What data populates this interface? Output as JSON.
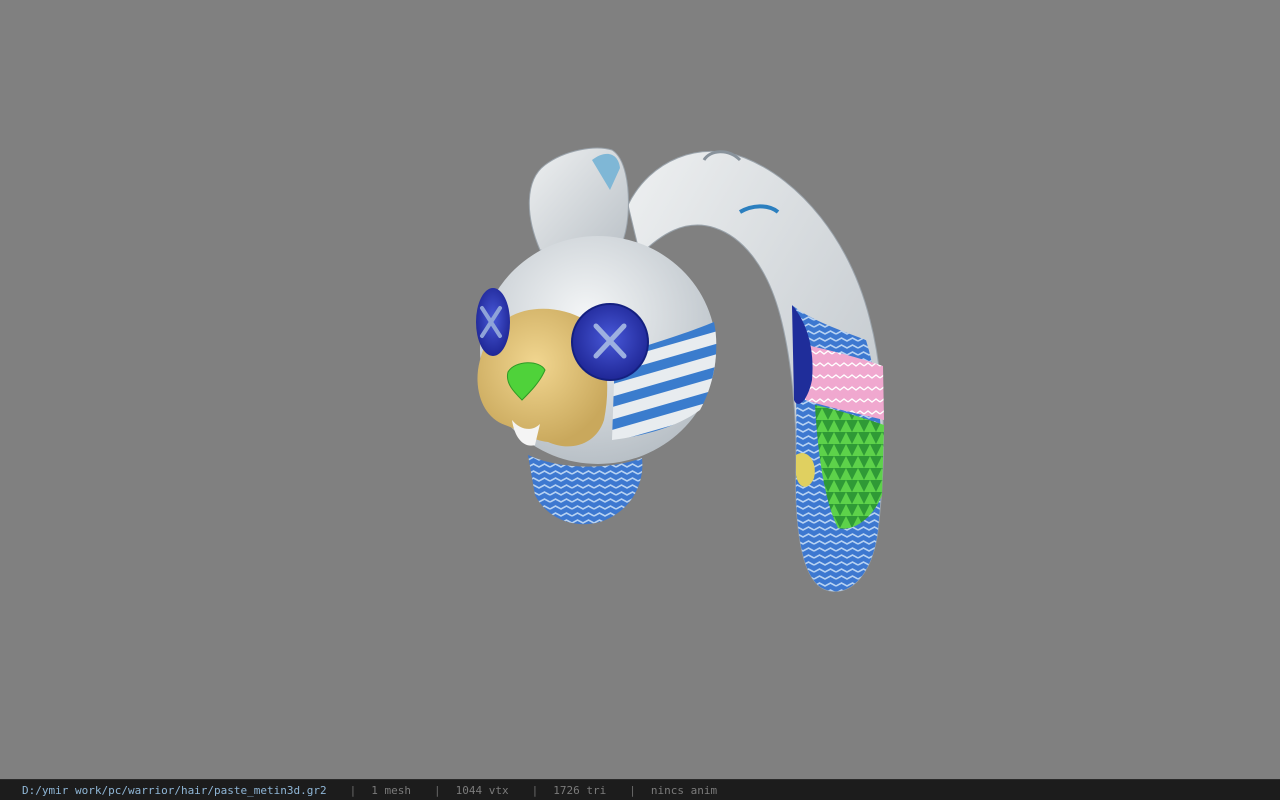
{
  "viewport": {
    "background_color": "#808080",
    "model": "bunny-hat"
  },
  "status_bar": {
    "file_path": "D:/ymir work/pc/warrior/hair/paste_metin3d.gr2",
    "separator": "|",
    "mesh_count": "1 mesh",
    "vertex_count": "1044 vtx",
    "triangle_count": "1726 tri",
    "anim_status": "nincs anim"
  }
}
